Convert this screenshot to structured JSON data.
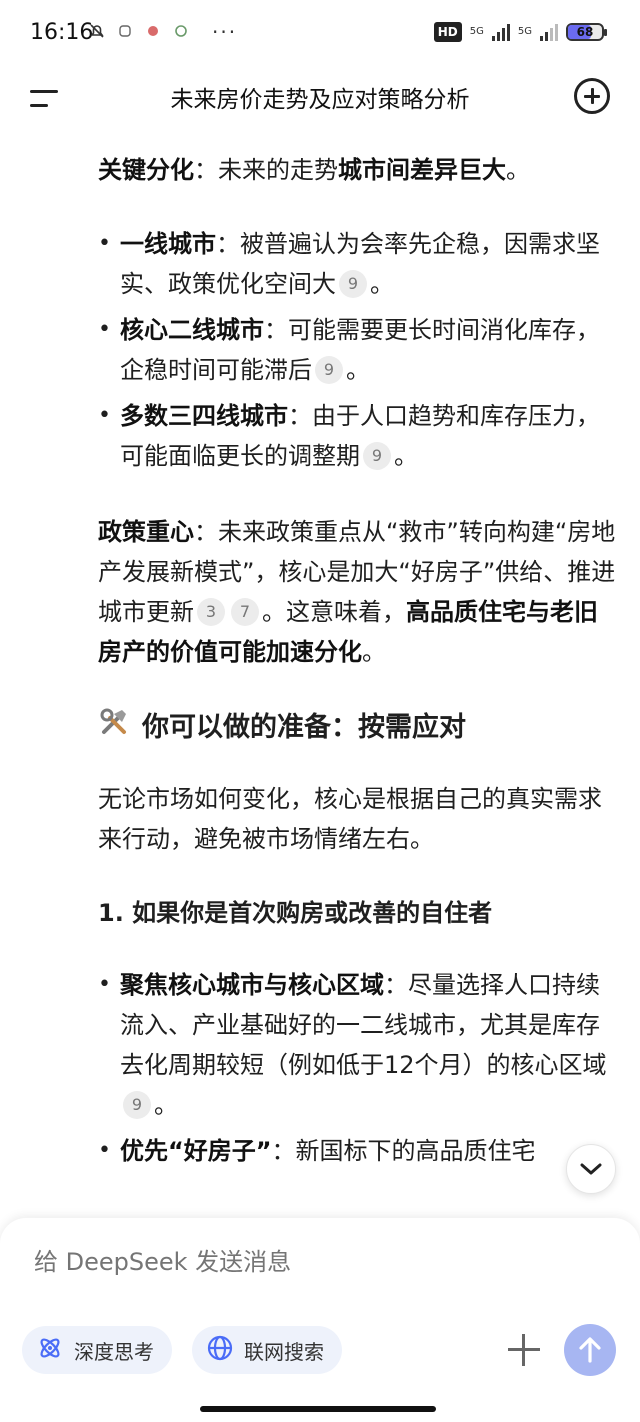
{
  "status_bar": {
    "time": "16:16",
    "dots": "···",
    "hd": "HD",
    "net1": "5G",
    "net2": "5G",
    "battery": "68",
    "battery_level": 0.68
  },
  "header": {
    "title": "未来房价走势及应对策略分析"
  },
  "content": {
    "p1": {
      "bold": "关键分化",
      "text": "：未来的走势",
      "bold2": "城市间差异巨大",
      "end": "。"
    },
    "bullets1": [
      {
        "bold": "一线城市",
        "text": "：被普遍认为会率先企稳，因需求坚实、政策优化空间大",
        "cite": "9",
        "end": "。"
      },
      {
        "bold": "核心二线城市",
        "text": "：可能需要更长时间消化库存，企稳时间可能滞后",
        "cite": "9",
        "end": "。"
      },
      {
        "bold": "多数三四线城市",
        "text": "：由于人口趋势和库存压力，可能面临更长的调整期",
        "cite": "9",
        "end": "。"
      }
    ],
    "p2": {
      "bold": "政策重心",
      "text": "：未来政策重点从“救市”转向构建“房地产发展新模式”，核心是加大“好房子”供给、推进城市更新",
      "cite1": "3",
      "cite2": "7",
      "text2": "。这意味着，",
      "bold2": "高品质住宅与老旧房产的价值可能加速分化",
      "end": "。"
    },
    "section_heading": "你可以做的准备：按需应对",
    "p3": "无论市场如何变化，核心是根据自己的真实需求来行动，避免被市场情绪左右。",
    "sub_heading": "1. 如果你是首次购房或改善的自住者",
    "bullets2": [
      {
        "bold": "聚焦核心城市与核心区域",
        "text": "：尽量选择人口持续流入、产业基础好的一二线城市，尤其是库存去化周期较短（例如低于12个月）的核心区域",
        "cite": "9",
        "end": "。"
      },
      {
        "bold": "优先“好房子”",
        "text": "：新国标下的高品质住宅"
      }
    ]
  },
  "composer": {
    "placeholder": "给 DeepSeek 发送消息",
    "deep_think": "深度思考",
    "web_search": "联网搜索"
  },
  "colors": {
    "send_button": "#a7b6f2",
    "pill_bg": "#eef2fb",
    "pill_icon": "#4a6cf7"
  }
}
